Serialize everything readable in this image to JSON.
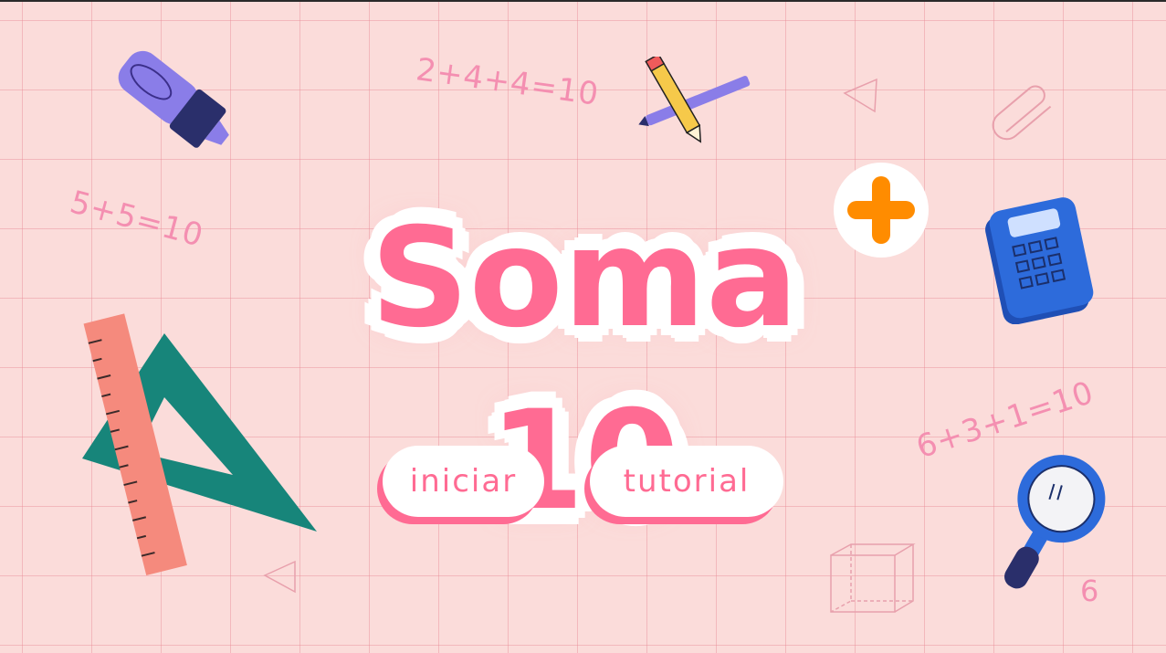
{
  "title": {
    "text": "Soma 10",
    "badge": "+"
  },
  "buttons": {
    "start_label": "iniciar",
    "tutorial_label": "tutorial"
  },
  "equations": {
    "eq1": "2+4+4=10",
    "eq2": "5+5=10",
    "eq3": "6+3+1=10",
    "eq4": "6"
  },
  "colors": {
    "background": "#fbdcda",
    "accent_pink": "#ff6b93",
    "badge_orange": "#ff8c00"
  },
  "icons": [
    "highlighter-icon",
    "pencil-icon",
    "triangle-outline-icon",
    "paperclip-icon",
    "calculator-icon",
    "ruler-icon",
    "set-square-icon",
    "magnifier-icon",
    "cube-outline-icon"
  ]
}
